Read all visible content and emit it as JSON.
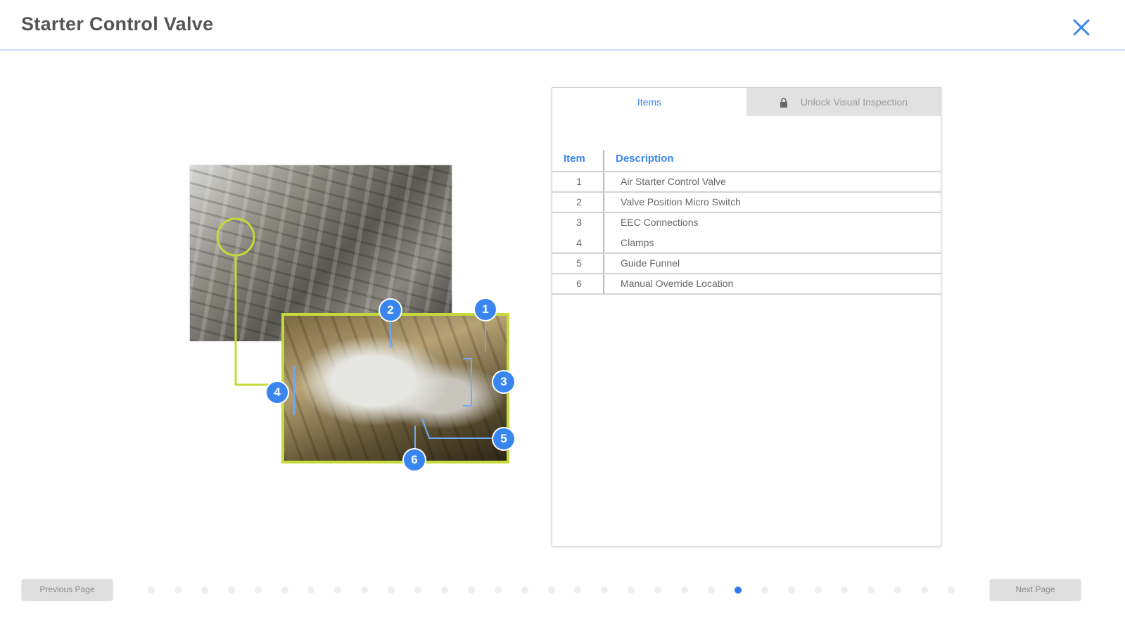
{
  "header": {
    "title": "Starter Control Valve",
    "close_icon": "close-icon",
    "accent_color": "#3a86f0"
  },
  "figure": {
    "callout_color": "#c6d93a",
    "markers": [
      "1",
      "2",
      "3",
      "4",
      "5",
      "6"
    ]
  },
  "panel": {
    "tabs": [
      {
        "label": "Items",
        "active": true
      },
      {
        "label": "Unlock Visual Inspection",
        "icon": "lock-icon",
        "active": false
      }
    ],
    "table": {
      "headers": [
        "Item",
        "Description"
      ],
      "rows": [
        {
          "item": "1",
          "description": "Air Starter Control Valve"
        },
        {
          "item": "2",
          "description": "Valve Position Micro Switch"
        },
        {
          "item": "3",
          "description": "EEC Connections"
        },
        {
          "item": "4",
          "description": "Clamps"
        },
        {
          "item": "5",
          "description": "Guide Funnel"
        },
        {
          "item": "6",
          "description": "Manual Override Location"
        }
      ]
    }
  },
  "footer": {
    "previous_label": "Previous Page",
    "next_label": "Next Page",
    "pagination": {
      "total": 31,
      "current": 23
    }
  }
}
